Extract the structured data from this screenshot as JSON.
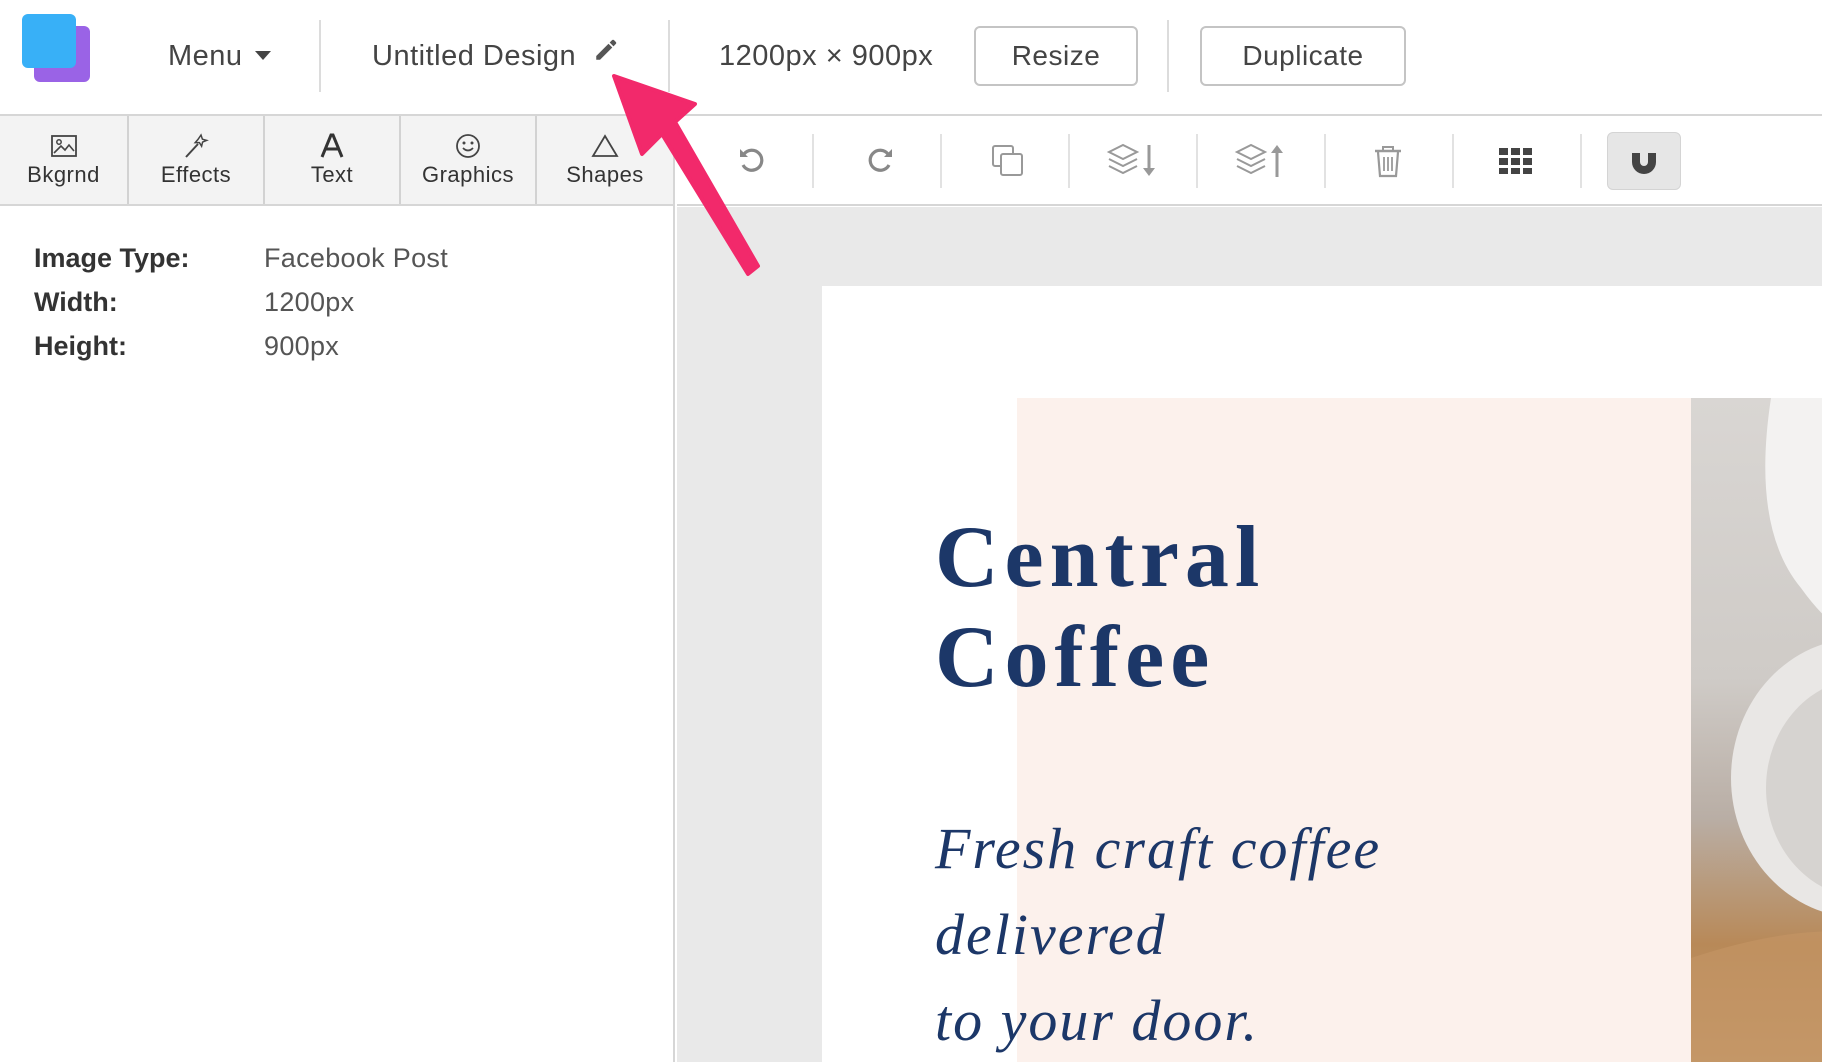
{
  "topbar": {
    "menu_label": "Menu",
    "design_title": "Untitled Design",
    "dimensions": "1200px × 900px",
    "resize_label": "Resize",
    "duplicate_label": "Duplicate"
  },
  "tabs": [
    {
      "label": "Bkgrnd",
      "icon": "image-icon"
    },
    {
      "label": "Effects",
      "icon": "magic-wand-icon"
    },
    {
      "label": "Text",
      "icon": "text-icon"
    },
    {
      "label": "Graphics",
      "icon": "smiley-icon"
    },
    {
      "label": "Shapes",
      "icon": "triangle-icon"
    }
  ],
  "info": {
    "type_key": "Image Type:",
    "type_val": "Facebook Post",
    "width_key": "Width:",
    "width_val": "1200px",
    "height_key": "Height:",
    "height_val": "900px"
  },
  "toolbar": {
    "tools": [
      "undo-icon",
      "redo-icon",
      "copy-icon",
      "layer-down-icon",
      "layer-up-icon",
      "trash-icon",
      "grid-icon",
      "magnet-icon"
    ],
    "active_tool": "magnet-icon"
  },
  "canvas": {
    "headline_line1": "Central",
    "headline_line2": "Coffee",
    "tagline_line1": "Fresh craft coffee delivered",
    "tagline_line2": "to your door."
  },
  "colors": {
    "headline": "#1c3768",
    "peach_panel": "#fcf1ec",
    "arrow": "#f2296b",
    "logo_front": "#38b0f7",
    "logo_back": "#9a63e6"
  }
}
